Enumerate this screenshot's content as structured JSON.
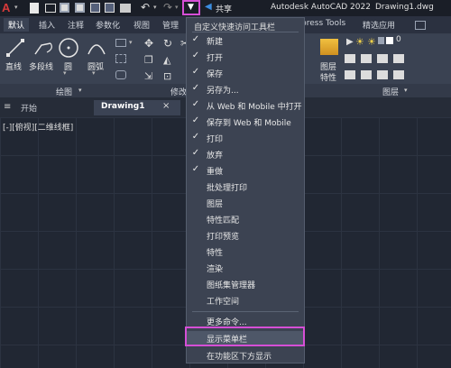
{
  "titlebar": {
    "share_label": "共享",
    "app_title": "Autodesk AutoCAD 2022",
    "file_name": "Drawing1.dwg"
  },
  "ribbon_tabs": [
    "默认",
    "插入",
    "注释",
    "参数化",
    "视图",
    "管理",
    "press Tools",
    "精选应用"
  ],
  "ribbon_tools": {
    "line": "直线",
    "polyline": "多段线",
    "circle": "圆",
    "arc": "圆弧",
    "layer_props": "图层\n特性",
    "layer_props_1": "图层",
    "layer_props_2": "特性"
  },
  "panel_labels": {
    "draw": "绘图",
    "modify": "修改",
    "layer": "图层"
  },
  "doc_tabs": {
    "start": "开始",
    "drawing": "Drawing1"
  },
  "viewport_label": "[-][俯视][二维线框]",
  "qat_menu": {
    "header": "自定义快速访问工具栏",
    "items": [
      {
        "label": "新建",
        "checked": true
      },
      {
        "label": "打开",
        "checked": true
      },
      {
        "label": "保存",
        "checked": true
      },
      {
        "label": "另存为...",
        "checked": true
      },
      {
        "label": "从 Web 和 Mobile 中打开",
        "checked": true
      },
      {
        "label": "保存到 Web 和 Mobile",
        "checked": true
      },
      {
        "label": "打印",
        "checked": true
      },
      {
        "label": "放弃",
        "checked": true
      },
      {
        "label": "重做",
        "checked": true
      },
      {
        "label": "批处理打印",
        "checked": false
      },
      {
        "label": "图层",
        "checked": false
      },
      {
        "label": "特性匹配",
        "checked": false
      },
      {
        "label": "打印预览",
        "checked": false
      },
      {
        "label": "特性",
        "checked": false
      },
      {
        "label": "渲染",
        "checked": false
      },
      {
        "label": "图纸集管理器",
        "checked": false
      },
      {
        "label": "工作空间",
        "checked": false
      }
    ],
    "more": "更多命令...",
    "show_menubar": "显示菜单栏",
    "show_below": "在功能区下方显示"
  },
  "check_glyph": "✓",
  "colors": {
    "highlight": "#d64fd6",
    "app_red": "#c8232c",
    "menu_bg": "#3c4352"
  }
}
